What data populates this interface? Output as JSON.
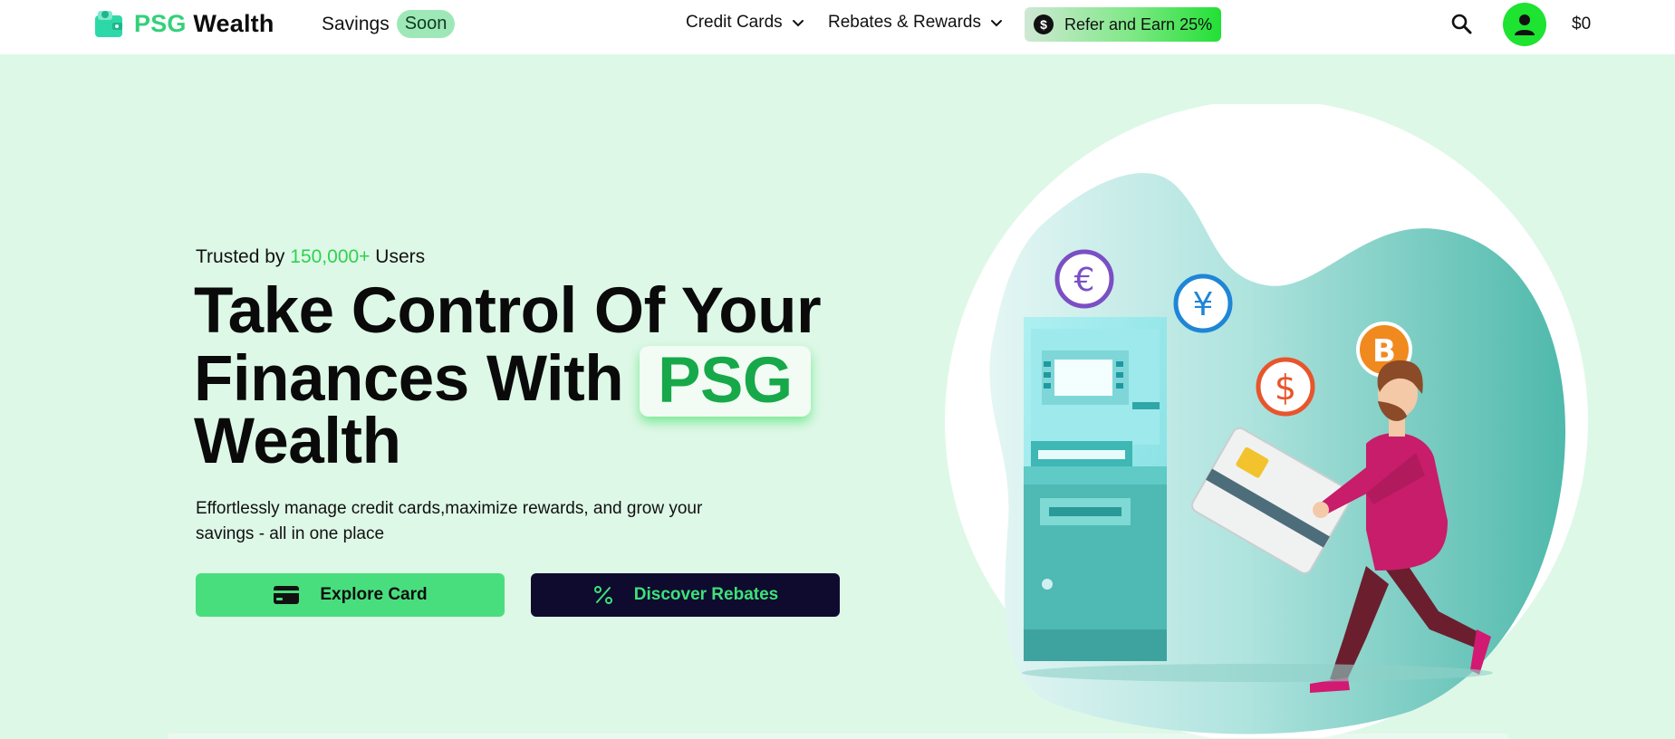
{
  "header": {
    "brand_part1": "PSG",
    "brand_part2": " Wealth",
    "savings_label": "Savings",
    "savings_badge": "Soon",
    "nav": [
      {
        "label": "Credit Cards",
        "icon": "chevron-down-icon"
      },
      {
        "label": "Rebates & Rewards",
        "icon": "chevron-down-icon"
      }
    ],
    "refer_label": "Refer and Earn 25%",
    "refer_icon_glyph": "$",
    "balance": "$0"
  },
  "hero": {
    "trusted_prefix": "Trusted by ",
    "trusted_count": "150,000+",
    "trusted_suffix": " Users",
    "headline_line1": "Take Control Of Your",
    "headline_line2": "Finances With",
    "headline_highlight": "PSG",
    "headline_line3": "Wealth",
    "description": "Effortlessly manage credit cards,maximize rewards, and grow your savings - all in one place",
    "explore_label": "Explore Card",
    "rebates_label": "Discover Rebates"
  },
  "illustration": {
    "coins": [
      {
        "glyph": "€",
        "color": "#7b4fc4"
      },
      {
        "glyph": "¥",
        "color": "#1f86d6"
      },
      {
        "glyph": "$",
        "color": "#e8552c"
      },
      {
        "glyph": "B",
        "color": "#f08a1f"
      }
    ]
  },
  "colors": {
    "brand_green": "#33d17a",
    "hero_bg": "#def8e7",
    "avatar_green": "#1ee331",
    "dark_button": "#0f0b2e"
  }
}
